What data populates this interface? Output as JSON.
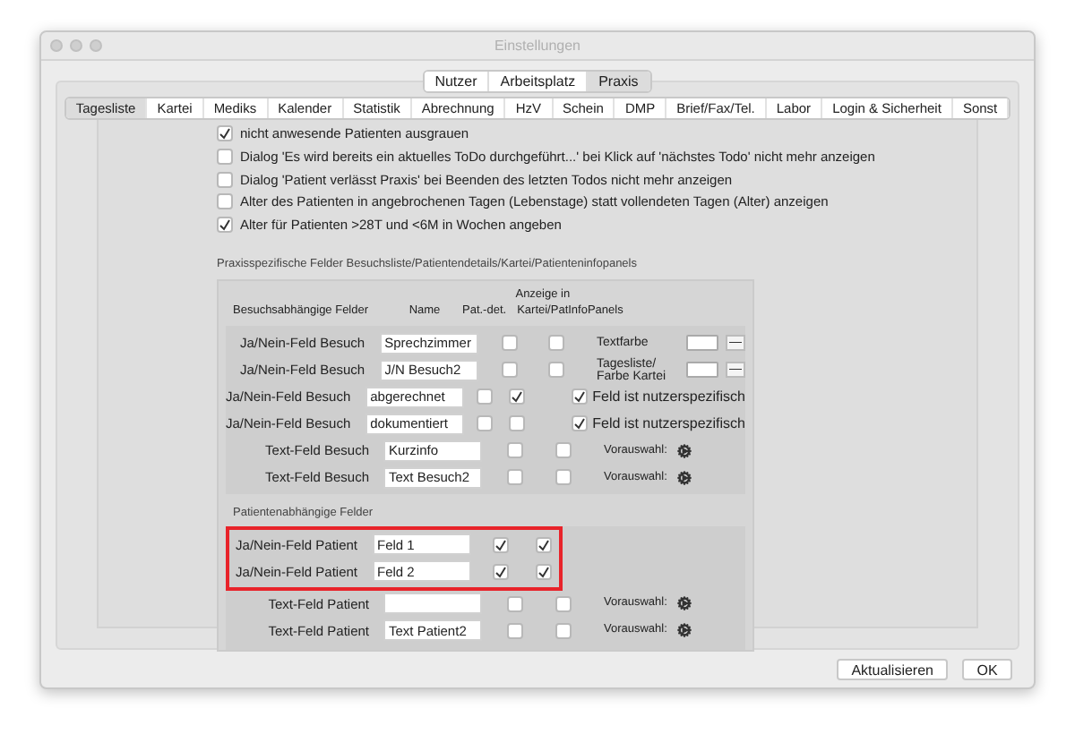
{
  "window": {
    "title": "Einstellungen"
  },
  "top_tabs": [
    {
      "label": "Nutzer",
      "selected": false
    },
    {
      "label": "Arbeitsplatz",
      "selected": false
    },
    {
      "label": "Praxis",
      "selected": true
    }
  ],
  "sub_tabs": [
    {
      "label": "Tagesliste",
      "selected": true
    },
    {
      "label": "Kartei",
      "selected": false
    },
    {
      "label": "Mediks",
      "selected": false
    },
    {
      "label": "Kalender",
      "selected": false
    },
    {
      "label": "Statistik",
      "selected": false
    },
    {
      "label": "Abrechnung",
      "selected": false
    },
    {
      "label": "HzV",
      "selected": false
    },
    {
      "label": "Schein",
      "selected": false
    },
    {
      "label": "DMP",
      "selected": false
    },
    {
      "label": "Brief/Fax/Tel.",
      "selected": false
    },
    {
      "label": "Labor",
      "selected": false
    },
    {
      "label": "Login & Sicherheit",
      "selected": false
    },
    {
      "label": "Sonst",
      "selected": false
    }
  ],
  "options": [
    {
      "label": "nicht anwesende Patienten ausgrauen",
      "checked": true
    },
    {
      "label": "Dialog 'Es wird bereits ein aktuelles ToDo durchgeführt...' bei Klick auf 'nächstes Todo' nicht mehr anzeigen",
      "checked": false
    },
    {
      "label": "Dialog 'Patient verlässt Praxis' bei Beenden des letzten Todos nicht mehr anzeigen",
      "checked": false
    },
    {
      "label": "Alter des Patienten in angebrochenen Tagen (Lebenstage) statt vollendeten Tagen (Alter) anzeigen",
      "checked": false
    },
    {
      "label": "Alter für Patienten >28T und <6M in Wochen angeben",
      "checked": true
    }
  ],
  "praxis_fields": {
    "title": "Praxisspezifische Felder Besuchsliste/Patientendetails/Kartei/Patienteninfopanels",
    "name_header": "Name",
    "display_header": "Anzeige in",
    "pat_header": "Pat.-det.",
    "kartei_header": "Kartei/PatInfoPanels",
    "visit": {
      "title": "Besuchsabhängige Felder",
      "rows": [
        {
          "label": "Ja/Nein-Feld Besuch",
          "name": "Sprechzimmer",
          "pat": false,
          "kartei": false,
          "extra": {
            "kind": "color",
            "label": "Textfarbe",
            "button": "—"
          }
        },
        {
          "label": "Ja/Nein-Feld Besuch",
          "name": "J/N Besuch2",
          "pat": false,
          "kartei": false,
          "extra": {
            "kind": "color",
            "label": "Tagesliste/ Farbe Kartei",
            "button": "—"
          }
        },
        {
          "label": "Ja/Nein-Feld Besuch",
          "name": "abgerechnet",
          "pat": false,
          "kartei": true,
          "extra": {
            "kind": "user",
            "label": "Feld ist nutzerspezifisch",
            "checked": true
          }
        },
        {
          "label": "Ja/Nein-Feld Besuch",
          "name": "dokumentiert",
          "pat": false,
          "kartei": false,
          "extra": {
            "kind": "user",
            "label": "Feld ist nutzerspezifisch",
            "checked": true
          }
        },
        {
          "label": "Text-Feld Besuch",
          "name": "Kurzinfo",
          "pat": false,
          "kartei": false,
          "extra": {
            "kind": "preset",
            "label": "Vorauswahl:"
          }
        },
        {
          "label": "Text-Feld Besuch",
          "name": "Text Besuch2",
          "pat": false,
          "kartei": false,
          "extra": {
            "kind": "preset",
            "label": "Vorauswahl:"
          }
        }
      ]
    },
    "patient": {
      "title": "Patientenabhängige Felder",
      "rows": [
        {
          "label": "Ja/Nein-Feld Patient",
          "name": "Feld 1",
          "pat": true,
          "kartei": true,
          "highlighted": true
        },
        {
          "label": "Ja/Nein-Feld Patient",
          "name": "Feld 2",
          "pat": true,
          "kartei": true,
          "highlighted": true
        },
        {
          "label": "Text-Feld Patient",
          "pat": false,
          "kartei": false,
          "highlighted": false,
          "extra": {
            "kind": "preset",
            "label": "Vorauswahl:"
          }
        },
        {
          "label": "Text-Feld Patient",
          "name": "Text Patient2",
          "pat": false,
          "kartei": false,
          "highlighted": false,
          "extra": {
            "kind": "preset",
            "label": "Vorauswahl:"
          }
        }
      ]
    }
  },
  "buttons": [
    {
      "label": "Aktualisieren",
      "default": false
    },
    {
      "label": "OK",
      "default": false
    }
  ]
}
